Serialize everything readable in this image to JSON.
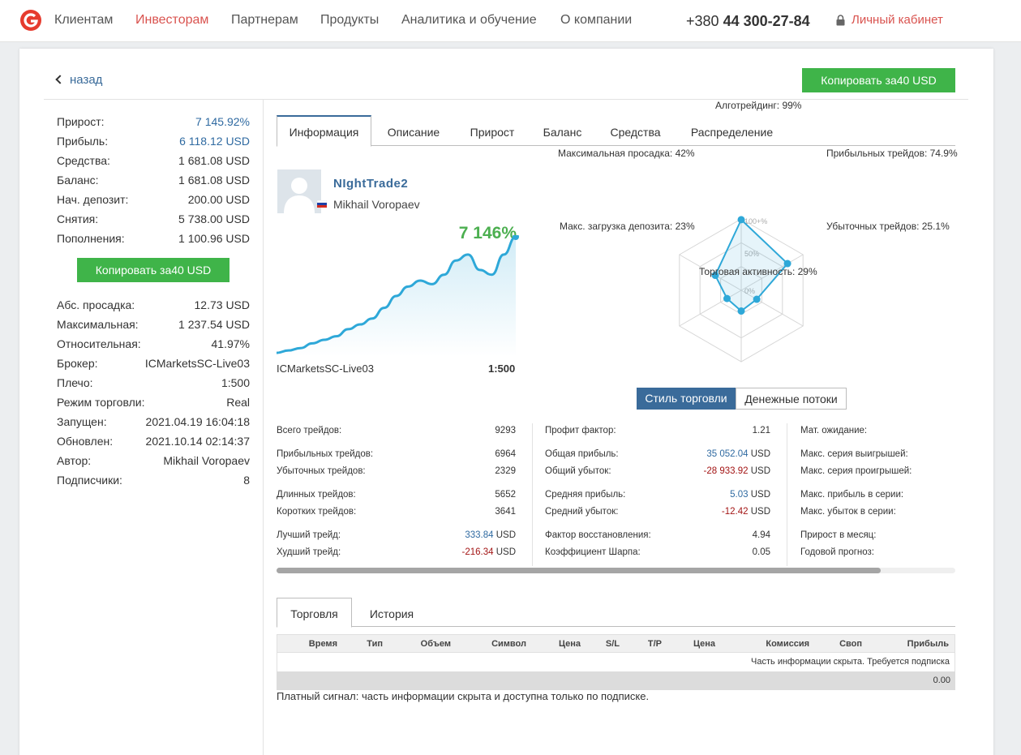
{
  "nav": {
    "items": [
      "Клиентам",
      "Инвесторам",
      "Партнерам",
      "Продукты",
      "Аналитика и обучение",
      "О компании"
    ],
    "active_index": 1,
    "phone_prefix": "+380",
    "phone_number": "44 300-27-84",
    "cabinet": "Личный кабинет"
  },
  "back_label": "назад",
  "copy_button": "Копировать за40  USD",
  "left_stats_top": [
    {
      "label": "Прирост:",
      "value": "7 145.92%",
      "color": "blue"
    },
    {
      "label": "Прибыль:",
      "value": "6 118.12 USD",
      "color": "blue"
    },
    {
      "label": "Средства:",
      "value": "1 681.08 USD"
    },
    {
      "label": "Баланс:",
      "value": "1 681.08 USD"
    },
    {
      "label": "Нач. депозит:",
      "value": "200.00 USD"
    },
    {
      "label": "Снятия:",
      "value": "5 738.00 USD"
    },
    {
      "label": "Пополнения:",
      "value": "1 100.96 USD"
    }
  ],
  "left_stats_bottom": [
    {
      "label": "Абс. просадка:",
      "value": "12.73 USD"
    },
    {
      "label": "Максимальная:",
      "value": "1 237.54 USD"
    },
    {
      "label": "Относительная:",
      "value": "41.97%"
    },
    {
      "label": "Брокер:",
      "value": "ICMarketsSC-Live03"
    },
    {
      "label": "Плечо:",
      "value": "1:500"
    },
    {
      "label": "Режим торговли:",
      "value": "Real"
    },
    {
      "label": "Запущен:",
      "value": "2021.04.19 16:04:18"
    },
    {
      "label": "Обновлен:",
      "value": "2021.10.14 02:14:37"
    },
    {
      "label": "Автор:",
      "value": "Mikhail Voropaev"
    },
    {
      "label": "Подписчики:",
      "value": "8"
    }
  ],
  "tabs": [
    "Информация",
    "Описание",
    "Прирост",
    "Баланс",
    "Средства",
    "Распределение"
  ],
  "active_tab": 0,
  "trader": {
    "name": "NIghtTrade2",
    "author": "Mikhail Voropaev",
    "growth": "7 146%",
    "broker": "ICMarketsSC-Live03",
    "leverage": "1:500"
  },
  "growth_curve": [
    2,
    4,
    6,
    10,
    13,
    16,
    22,
    26,
    31,
    40,
    50,
    58,
    63,
    60,
    68,
    80,
    85,
    72,
    68,
    85,
    100
  ],
  "radar": {
    "scale_labels": [
      "100+%",
      "50%",
      "0%"
    ],
    "axes": [
      {
        "label": "Алготрейдинг: 99%",
        "value": 99
      },
      {
        "label": "Прибыльных трейдов: 74.9%",
        "value": 74.9
      },
      {
        "label": "Убыточных трейдов: 25.1%",
        "value": 25.1
      },
      {
        "label": "Торговая активность: 29%",
        "value": 29
      },
      {
        "label": "Макс. загрузка депозита: 23%",
        "value": 23
      },
      {
        "label": "Максимальная просадка: 42%",
        "value": 42
      }
    ]
  },
  "style_tabs": [
    "Стиль торговли",
    "Денежные потоки"
  ],
  "metrics": [
    [
      {
        "label": "Всего трейдов:",
        "value": "9293"
      },
      null,
      {
        "label": "Прибыльных трейдов:",
        "value": "6964"
      },
      {
        "label": "Убыточных трейдов:",
        "value": "2329"
      },
      null,
      {
        "label": "Длинных трейдов:",
        "value": "5652"
      },
      {
        "label": "Коротких трейдов:",
        "value": "3641"
      },
      null,
      {
        "label": "Лучший трейд:",
        "value": "333.84",
        "unit": "USD",
        "color": "blue"
      },
      {
        "label": "Худший трейд:",
        "value": "-216.34",
        "unit": "USD",
        "color": "red"
      }
    ],
    [
      {
        "label": "Профит фактор:",
        "value": "1.21"
      },
      null,
      {
        "label": "Общая прибыль:",
        "value": "35 052.04",
        "unit": "USD",
        "color": "blue"
      },
      {
        "label": "Общий убыток:",
        "value": "-28 933.92",
        "unit": "USD",
        "color": "red"
      },
      null,
      {
        "label": "Средняя прибыль:",
        "value": "5.03",
        "unit": "USD",
        "color": "blue"
      },
      {
        "label": "Средний убыток:",
        "value": "-12.42",
        "unit": "USD",
        "color": "red"
      },
      null,
      {
        "label": "Фактор восстановления:",
        "value": "4.94"
      },
      {
        "label": "Коэффициент Шарпа:",
        "value": "0.05"
      }
    ],
    [
      {
        "label": "Мат. ожидание:",
        "value": ""
      },
      null,
      {
        "label": "Макс. серия выигрышей:",
        "value": ""
      },
      {
        "label": "Макс. серия проигрышей:",
        "value": ""
      },
      null,
      {
        "label": "Макс. прибыль в серии:",
        "value": ""
      },
      {
        "label": "Макс. убыток в серии:",
        "value": ""
      },
      null,
      {
        "label": "Прирост в месяц:",
        "value": ""
      },
      {
        "label": "Годовой прогноз:",
        "value": ""
      }
    ]
  ],
  "bottom_tabs": [
    "Торговля",
    "История"
  ],
  "table": {
    "headers": [
      "Время",
      "Тип",
      "Объем",
      "Символ",
      "Цена",
      "S/L",
      "T/P",
      "Цена",
      "Комиссия",
      "Своп",
      "Прибыль"
    ],
    "hidden_note": "Часть информации скрыта. Требуется подписка",
    "total": "0.00"
  },
  "paid_note": "Платный сигнал: часть информации скрыта и доступна только по подписке.",
  "colors": {
    "accent": "#3a6b9a",
    "green": "#3fb449",
    "red": "#d9534f",
    "chart": "#2ea8d8"
  }
}
